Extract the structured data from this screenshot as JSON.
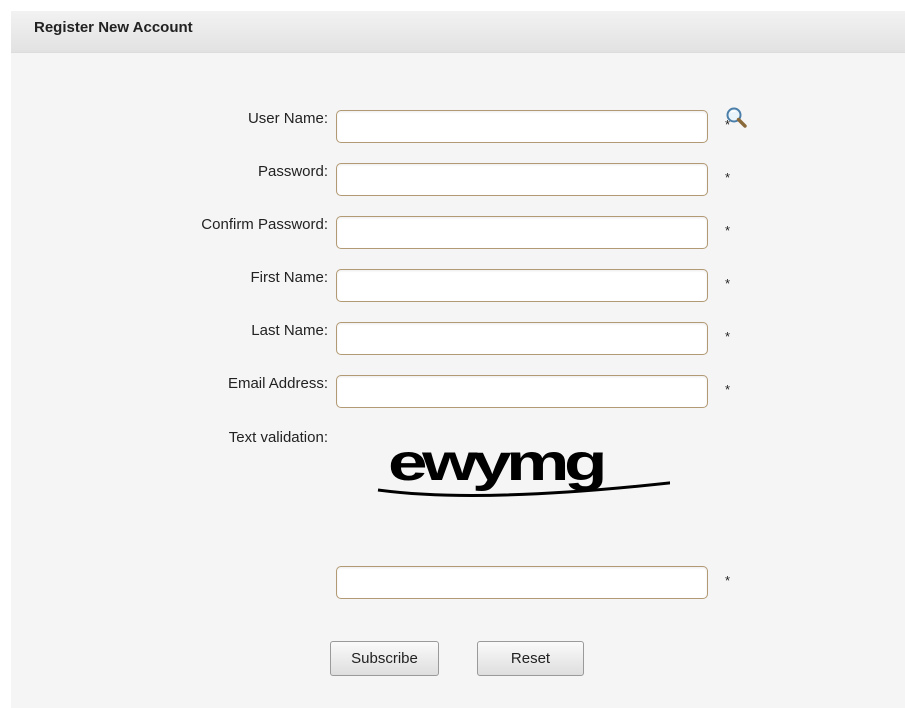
{
  "panel": {
    "title": "Register New Account"
  },
  "form": {
    "fields": [
      {
        "label": "User Name:",
        "value": "",
        "required_marker": "*"
      },
      {
        "label": "Password:",
        "value": "",
        "required_marker": "*"
      },
      {
        "label": "Confirm Password:",
        "value": "",
        "required_marker": "*"
      },
      {
        "label": "First Name:",
        "value": "",
        "required_marker": "*"
      },
      {
        "label": "Last Name:",
        "value": "",
        "required_marker": "*"
      },
      {
        "label": "Email Address:",
        "value": "",
        "required_marker": "*"
      }
    ],
    "captcha": {
      "label": "Text validation:",
      "image_text": "ewymg",
      "value": "",
      "required_marker": "*"
    },
    "username_lookup_icon": "magnifier-icon"
  },
  "buttons": {
    "subscribe": "Subscribe",
    "reset": "Reset"
  },
  "colors": {
    "field_border": "#b29a74",
    "panel_background": "#f5f5f5",
    "header_background": "#e8e8e8"
  }
}
